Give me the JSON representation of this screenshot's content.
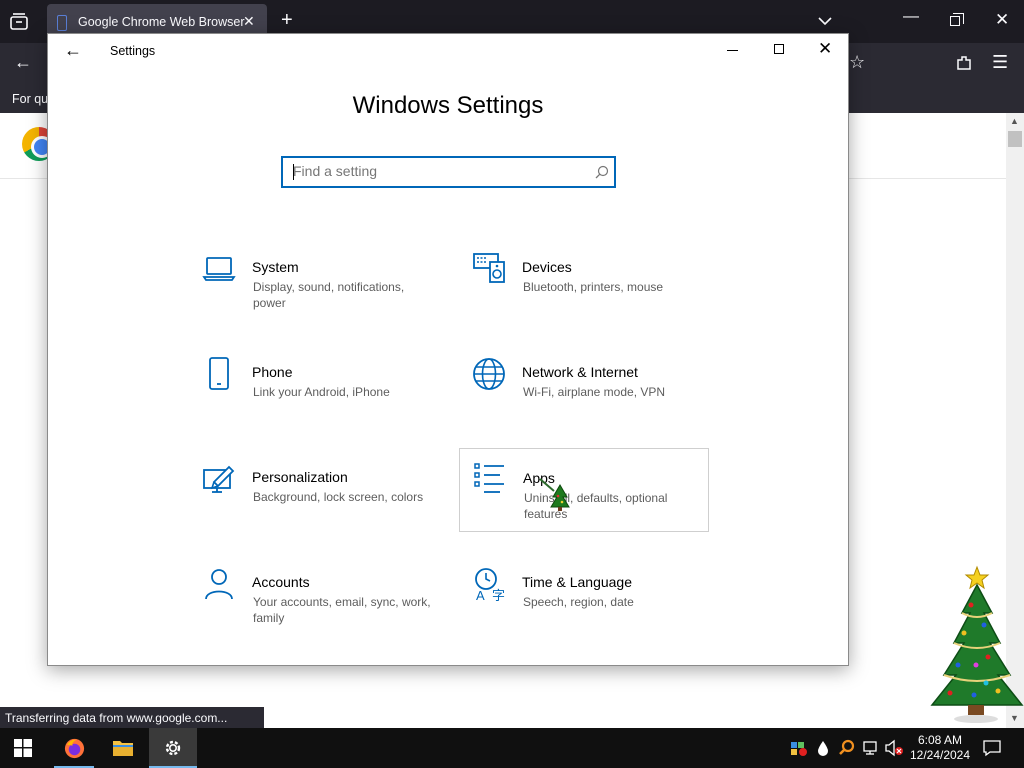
{
  "browser": {
    "tab_title": "Google Chrome Web Browser",
    "bookmark_text": "For qu",
    "status_text": "Transferring data from www.google.com..."
  },
  "settings": {
    "window_title": "Settings",
    "heading": "Windows Settings",
    "search_placeholder": "Find a setting",
    "search_value": "",
    "categories": [
      {
        "title": "System",
        "desc": "Display, sound, notifications, power",
        "icon": "laptop-icon"
      },
      {
        "title": "Devices",
        "desc": "Bluetooth, printers, mouse",
        "icon": "keyboard-speaker-icon"
      },
      {
        "title": "Phone",
        "desc": "Link your Android, iPhone",
        "icon": "phone-icon"
      },
      {
        "title": "Network & Internet",
        "desc": "Wi-Fi, airplane mode, VPN",
        "icon": "globe-icon"
      },
      {
        "title": "Personalization",
        "desc": "Background, lock screen, colors",
        "icon": "paint-icon"
      },
      {
        "title": "Apps",
        "desc": "Uninstall, defaults, optional features",
        "icon": "apps-list-icon"
      },
      {
        "title": "Accounts",
        "desc": "Your accounts, email, sync, work, family",
        "icon": "person-icon"
      },
      {
        "title": "Time & Language",
        "desc": "Speech, region, date",
        "icon": "time-language-icon"
      }
    ]
  },
  "taskbar": {
    "time": "6:08 AM",
    "date": "12/24/2024",
    "apps": [
      "firefox-icon",
      "file-explorer-icon",
      "settings-gear-icon"
    ]
  },
  "colors": {
    "accent": "#0067b8",
    "browser_dark": "#1c1b22",
    "taskbar": "#101010"
  }
}
